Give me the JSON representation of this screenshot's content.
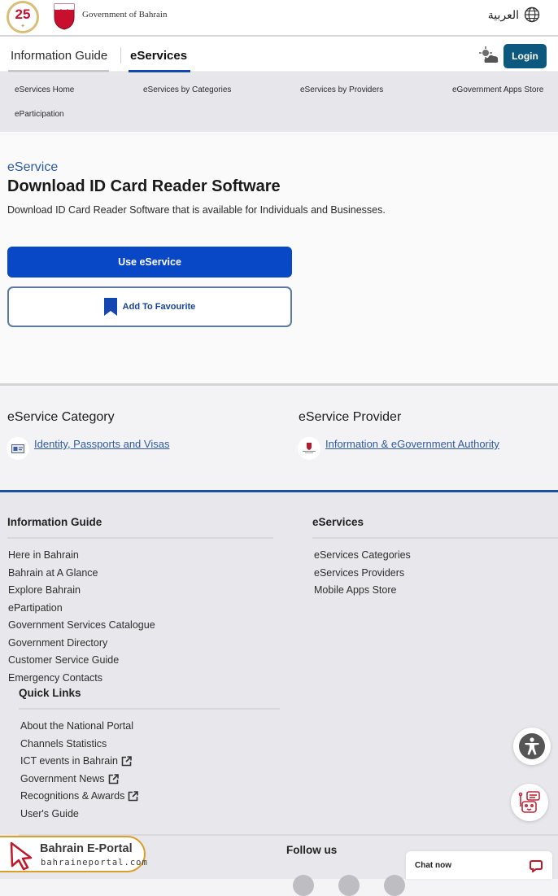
{
  "header": {
    "anniversary_badge": "25",
    "government_name": "Government of Bahrain",
    "language_toggle": "العربية",
    "login_label": "Login"
  },
  "nav": {
    "tabs": [
      {
        "label": "Information Guide",
        "active": false
      },
      {
        "label": "eServices",
        "active": true
      }
    ],
    "submenu": [
      {
        "label": "eServices Home"
      },
      {
        "label": "eServices by Categories"
      },
      {
        "label": "eServices by Providers"
      },
      {
        "label": "eGovernment Apps Store"
      },
      {
        "label": "eParticipation"
      }
    ]
  },
  "service": {
    "eyebrow": "eService",
    "title": "Download ID Card Reader Software",
    "description": "Download ID Card Reader Software that is available for Individuals and Businesses.",
    "use_button": "Use eService",
    "favourite_button": "Add To Favourite"
  },
  "meta": {
    "category_heading": "eService Category",
    "category_link": "Identity, Passports and Visas",
    "provider_heading": "eService Provider",
    "provider_link": "Information & eGovernment Authority"
  },
  "footer": {
    "info_guide": {
      "heading": "Information Guide",
      "links": [
        "Here in Bahrain",
        "Bahrain at A Glance",
        "Explore Bahrain",
        "ePartipation",
        "Government Services Catalogue",
        "Government Directory",
        "Customer Service Guide",
        "Emergency Contacts"
      ]
    },
    "eservices": {
      "heading": "eServices",
      "links": [
        "eServices Categories",
        "eServices Providers",
        "Mobile Apps Store"
      ]
    },
    "quick_links": {
      "heading": "Quick Links",
      "links": [
        {
          "label": "About the National Portal",
          "external": false
        },
        {
          "label": "Channels Statistics",
          "external": false
        },
        {
          "label": "ICT events in Bahrain",
          "external": true
        },
        {
          "label": "Government News",
          "external": true
        },
        {
          "label": "Recognitions & Awards",
          "external": true
        },
        {
          "label": "User's Guide",
          "external": false
        }
      ]
    },
    "follow_us": "Follow us"
  },
  "chat": {
    "label": "Chat now"
  },
  "watermark": {
    "title": "Bahrain E-Portal",
    "url": "bahraineportal.com"
  },
  "colors": {
    "primary": "#0847c6",
    "login": "#0d587f",
    "link": "#2f5aa5",
    "accent_rule": "#1a4fa8"
  }
}
